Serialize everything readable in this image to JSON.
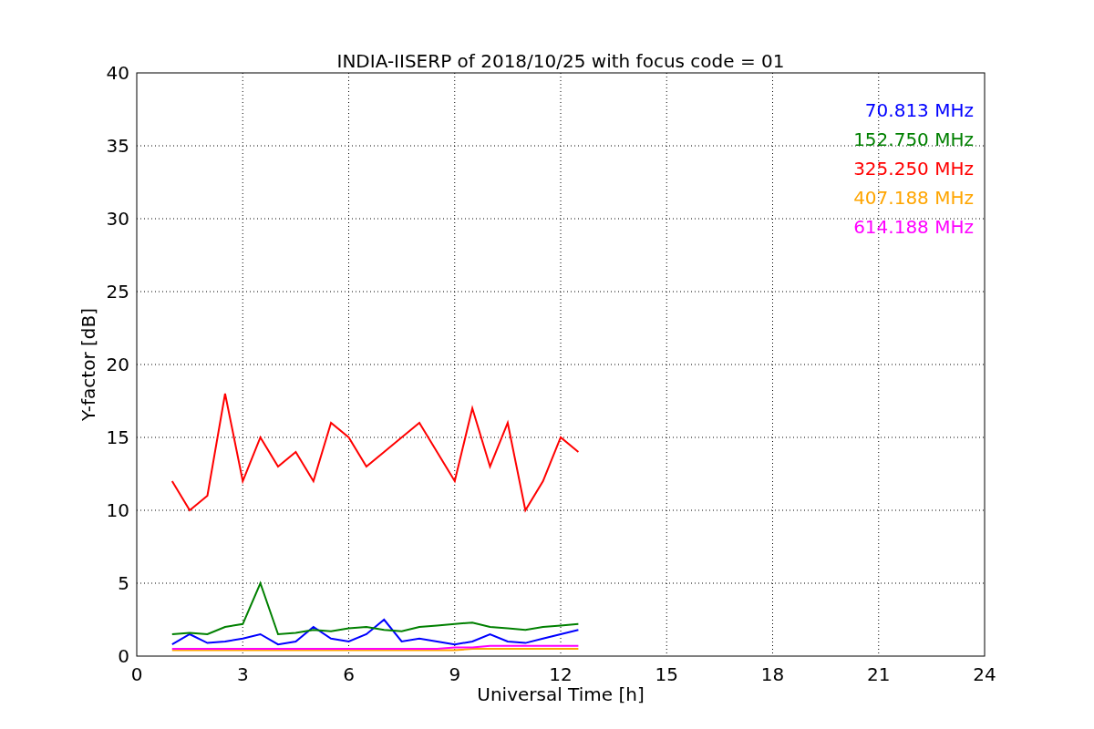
{
  "chart_data": {
    "type": "line",
    "title": "INDIA-IISERP of 2018/10/25 with focus code = 01",
    "xlabel": "Universal Time [h]",
    "ylabel": "Y-factor [dB]",
    "x": [
      1,
      1.5,
      2,
      2.5,
      3,
      3.5,
      4,
      4.5,
      5,
      5.5,
      6,
      6.5,
      7,
      7.5,
      8,
      8.5,
      9,
      9.5,
      10,
      10.5,
      11,
      11.5,
      12,
      12.5
    ],
    "series": [
      {
        "name": "70.813 MHz",
        "color": "#0000ff",
        "values": [
          0.8,
          1.5,
          0.9,
          1.0,
          1.2,
          1.5,
          0.8,
          1.0,
          2.0,
          1.2,
          1.0,
          1.5,
          2.5,
          1.0,
          1.2,
          1.0,
          0.8,
          1.0,
          1.5,
          1.0,
          0.9,
          1.2,
          1.5,
          1.8
        ]
      },
      {
        "name": "152.750 MHz",
        "color": "#008000",
        "values": [
          1.5,
          1.6,
          1.5,
          2.0,
          2.2,
          5.0,
          1.5,
          1.6,
          1.8,
          1.7,
          1.9,
          2.0,
          1.8,
          1.7,
          2.0,
          2.1,
          2.2,
          2.3,
          2.0,
          1.9,
          1.8,
          2.0,
          2.1,
          2.2
        ]
      },
      {
        "name": "325.250 MHz",
        "color": "#ff0000",
        "values": [
          12,
          10,
          11,
          18,
          12,
          15,
          13,
          14,
          12,
          16,
          15,
          13,
          14,
          15,
          16,
          14,
          12,
          17,
          13,
          16,
          10,
          12,
          15,
          14
        ]
      },
      {
        "name": "407.188 MHz",
        "color": "#ffa500",
        "values": [
          0.4,
          0.4,
          0.4,
          0.4,
          0.4,
          0.4,
          0.4,
          0.4,
          0.4,
          0.4,
          0.4,
          0.4,
          0.4,
          0.4,
          0.4,
          0.4,
          0.4,
          0.5,
          0.5,
          0.5,
          0.5,
          0.5,
          0.5,
          0.5
        ]
      },
      {
        "name": "614.188 MHz",
        "color": "#ff00ff",
        "values": [
          0.5,
          0.5,
          0.5,
          0.5,
          0.5,
          0.5,
          0.5,
          0.5,
          0.5,
          0.5,
          0.5,
          0.5,
          0.5,
          0.5,
          0.5,
          0.5,
          0.6,
          0.6,
          0.7,
          0.7,
          0.7,
          0.7,
          0.7,
          0.7
        ]
      }
    ],
    "grid": true,
    "xlim": [
      0,
      24
    ],
    "ylim": [
      0,
      40
    ],
    "xticks": [
      0,
      3,
      6,
      9,
      12,
      15,
      18,
      21,
      24
    ],
    "yticks": [
      0,
      5,
      10,
      15,
      20,
      25,
      30,
      35,
      40
    ]
  }
}
